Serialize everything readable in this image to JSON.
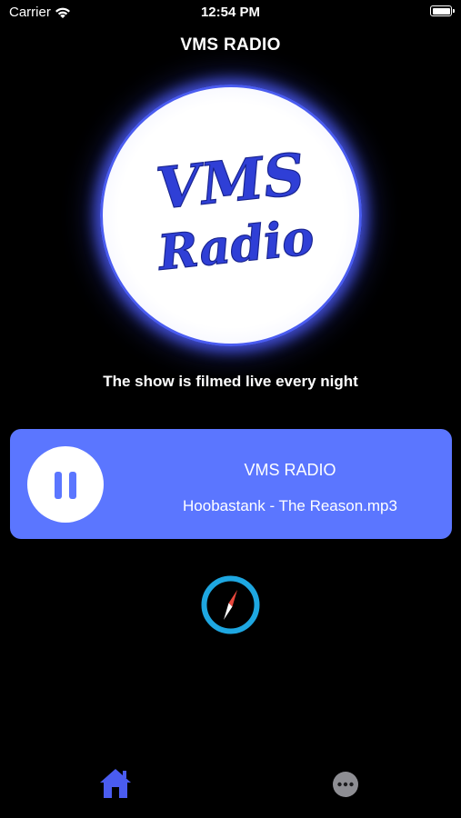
{
  "status_bar": {
    "carrier": "Carrier",
    "time": "12:54 PM"
  },
  "nav": {
    "title": "VMS RADIO"
  },
  "logo": {
    "line1": "VMS",
    "line2": "Radio",
    "text_color": "#2f3fd6",
    "ring_color": "#4a5cf0"
  },
  "tagline": "The show is filmed live every night",
  "player": {
    "station": "VMS RADIO",
    "track": "Hoobastank - The Reason.mp3",
    "state_icon": "pause-icon",
    "card_color": "#5b76ff"
  },
  "compass": {
    "icon": "compass-icon",
    "ring_color": "#1ea7e1"
  },
  "tab_bar": {
    "items": [
      {
        "icon": "home-icon",
        "active": true,
        "color": "#4a5cf0"
      },
      {
        "icon": "more-icon",
        "active": false,
        "color": "#8e8e93"
      }
    ]
  }
}
